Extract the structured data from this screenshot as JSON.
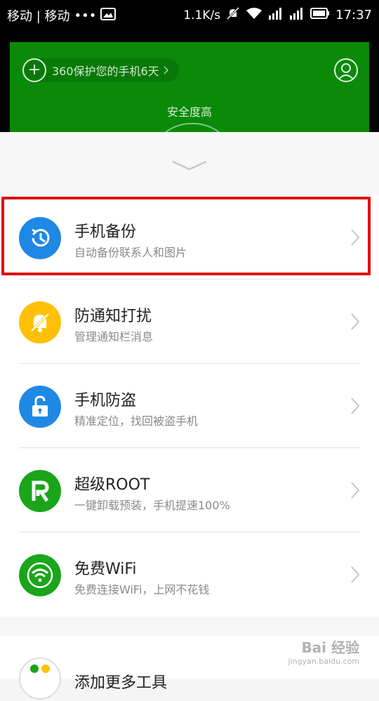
{
  "statusbar": {
    "carrier": "移动 | 移动",
    "dots": "•••",
    "speed": "1.1K/s",
    "time": "17:37"
  },
  "header": {
    "protect_text": "360保护您的手机6天",
    "status_text": "安全度高"
  },
  "list": {
    "items": [
      {
        "title": "手机备份",
        "subtitle": "自动备份联系人和图片",
        "icon": "history-clock-icon",
        "color": "#1e88e5"
      },
      {
        "title": "防通知打扰",
        "subtitle": "管理通知栏消息",
        "icon": "bell-off-icon",
        "color": "#ffc107"
      },
      {
        "title": "手机防盗",
        "subtitle": "精准定位，找回被盗手机",
        "icon": "unlock-icon",
        "color": "#1e88e5"
      },
      {
        "title": "超级ROOT",
        "subtitle": "一键卸载预装，手机提速100%",
        "icon": "root-r-icon",
        "color": "#1aa51a"
      },
      {
        "title": "免费WiFi",
        "subtitle": "免费连接WiFi，上网不花钱",
        "icon": "wifi-icon",
        "color": "#1aa51a"
      }
    ],
    "partial_title": "添加更多工具"
  },
  "watermark": {
    "text": "Bai 经验",
    "sub": "jingyan.baidu.com"
  },
  "colors": {
    "hero_green": "#0a8a08",
    "highlight_red": "#e01010"
  }
}
